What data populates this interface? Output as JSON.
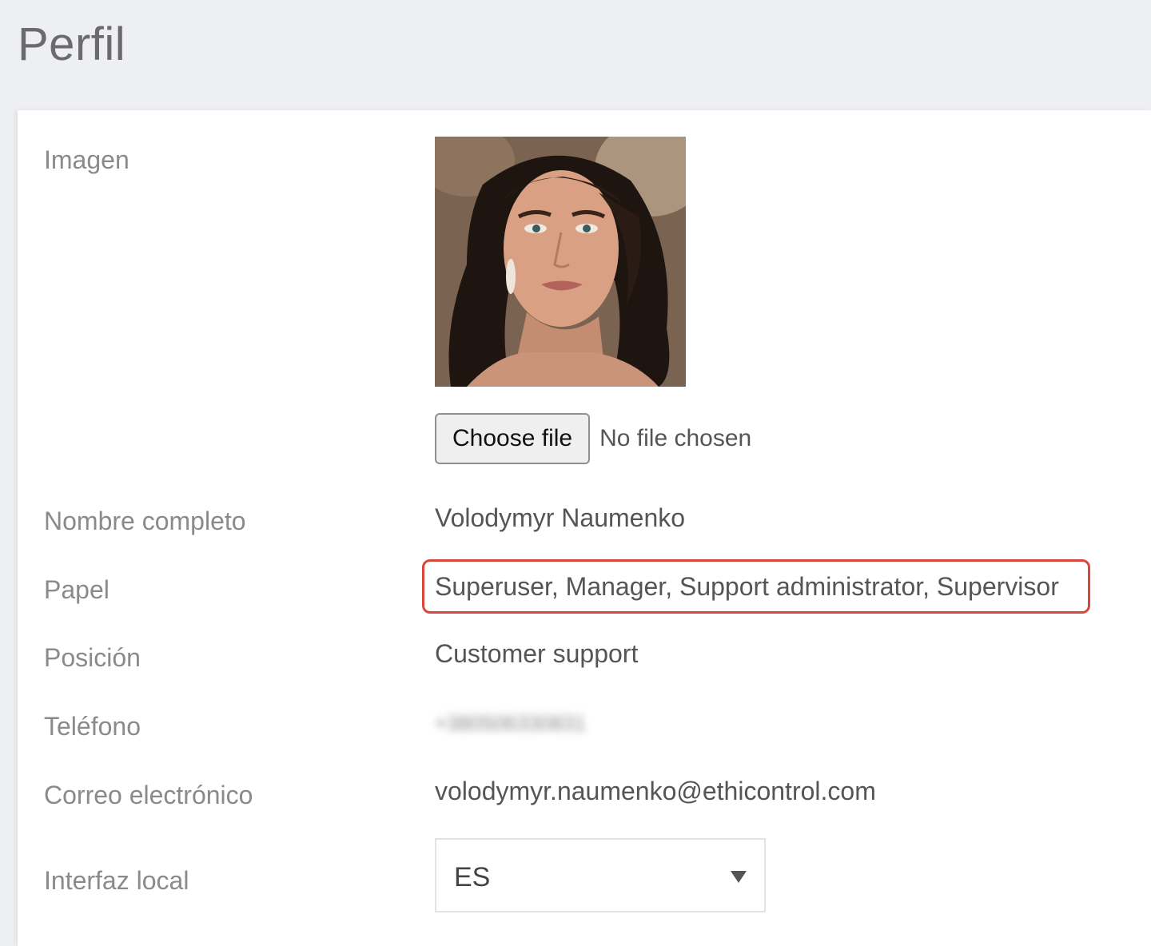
{
  "page": {
    "title": "Perfil"
  },
  "profile": {
    "image_label": "Imagen",
    "file_input": {
      "button_label": "Choose file",
      "status": "No file chosen"
    },
    "full_name_label": "Nombre completo",
    "full_name": "Volodymyr Naumenko",
    "role_label": "Papel",
    "role": "Superuser, Manager, Support administrator, Supervisor",
    "position_label": "Posición",
    "position": "Customer support",
    "phone_label": "Teléfono",
    "phone": "+380506330831",
    "email_label": "Correo electrónico",
    "email": "volodymyr.naumenko@ethicontrol.com",
    "locale_label": "Interfaz local",
    "locale_value": "ES"
  },
  "colors": {
    "highlight_border": "#d9473b",
    "header_background": "#eeeff2"
  }
}
